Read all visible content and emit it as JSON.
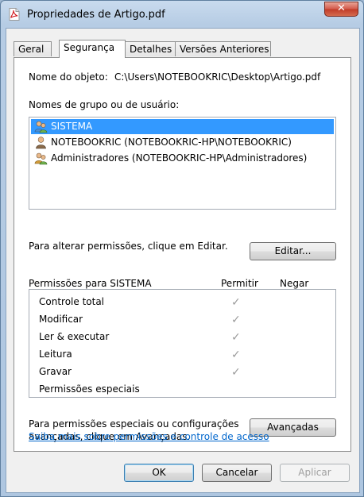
{
  "window": {
    "title": "Propriedades de Artigo.pdf",
    "close_symbol": "✕"
  },
  "tabs": [
    {
      "label": "Geral",
      "active": false
    },
    {
      "label": "Segurança",
      "active": true
    },
    {
      "label": "Detalhes",
      "active": false
    },
    {
      "label": "Versões Anteriores",
      "active": false
    }
  ],
  "object": {
    "label": "Nome do objeto:",
    "value": "C:\\Users\\NOTEBOOKRIC\\Desktop\\Artigo.pdf"
  },
  "groups": {
    "label": "Nomes de grupo ou de usuário:",
    "items": [
      {
        "label": "SISTEMA",
        "icon": "users-icon",
        "selected": true
      },
      {
        "label": "NOTEBOOKRIC (NOTEBOOKRIC-HP\\NOTEBOOKRIC)",
        "icon": "user-icon",
        "selected": false
      },
      {
        "label": "Administradores (NOTEBOOKRIC-HP\\Administradores)",
        "icon": "users-icon",
        "selected": false
      }
    ]
  },
  "edit": {
    "text": "Para alterar permissões, clique em Editar.",
    "button": "Editar..."
  },
  "permissions": {
    "title": "Permissões para SISTEMA",
    "col_allow": "Permitir",
    "col_deny": "Negar",
    "check_symbol": "✓",
    "rows": [
      {
        "name": "Controle total",
        "allow": true,
        "deny": false
      },
      {
        "name": "Modificar",
        "allow": true,
        "deny": false
      },
      {
        "name": "Ler & executar",
        "allow": true,
        "deny": false
      },
      {
        "name": "Leitura",
        "allow": true,
        "deny": false
      },
      {
        "name": "Gravar",
        "allow": true,
        "deny": false
      },
      {
        "name": "Permissões especiais",
        "allow": false,
        "deny": false
      }
    ]
  },
  "advanced": {
    "text_line1": "Para permissões especiais ou configurações",
    "text_line2": "avançadas, clique em Avançadas.",
    "button": "Avançadas"
  },
  "link": "Saiba mais sobre permissões e controle de acesso",
  "footer": {
    "ok": "OK",
    "cancel": "Cancelar",
    "apply": "Aplicar"
  },
  "colors": {
    "selection": "#3399ff",
    "link": "#0066cc",
    "close": "#c13b28"
  }
}
